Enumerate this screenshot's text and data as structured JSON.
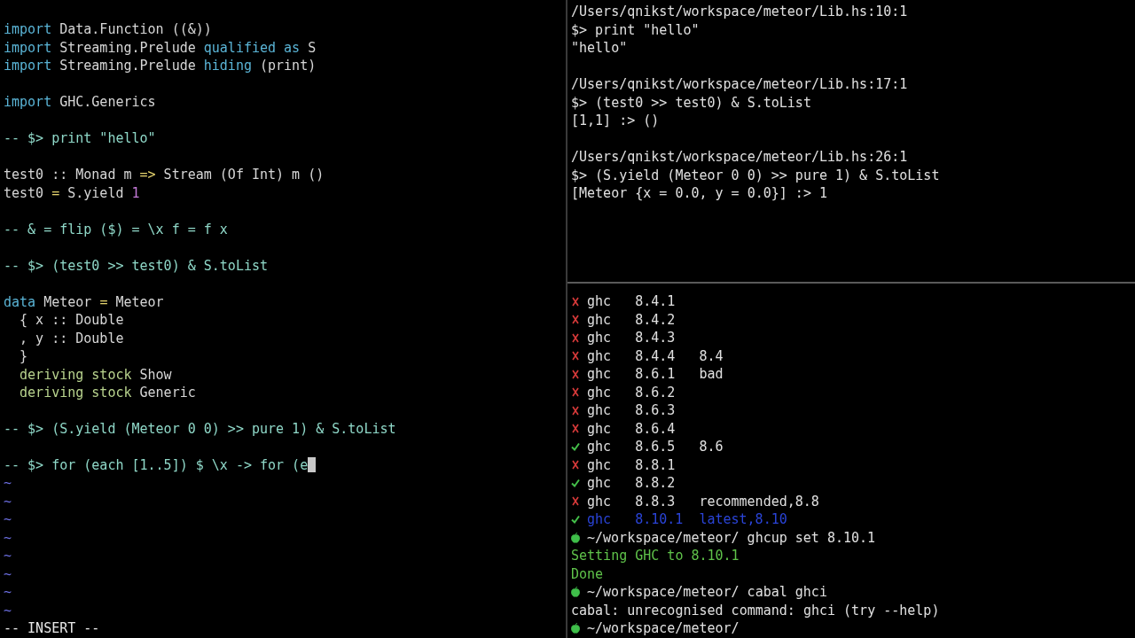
{
  "editor": {
    "lines": [
      {
        "kind": "blank"
      },
      {
        "kind": "code",
        "segments": [
          {
            "text": "import",
            "kind": "keyword"
          },
          {
            "text": " Data.Function ((&))",
            "kind": "plain"
          }
        ]
      },
      {
        "kind": "code",
        "segments": [
          {
            "text": "import",
            "kind": "keyword"
          },
          {
            "text": " Streaming.Prelude ",
            "kind": "plain"
          },
          {
            "text": "qualified as",
            "kind": "keyword"
          },
          {
            "text": " S",
            "kind": "plain"
          }
        ]
      },
      {
        "kind": "code",
        "segments": [
          {
            "text": "import",
            "kind": "keyword"
          },
          {
            "text": " Streaming.Prelude ",
            "kind": "plain"
          },
          {
            "text": "hiding",
            "kind": "keyword"
          },
          {
            "text": " (print)",
            "kind": "plain"
          }
        ]
      },
      {
        "kind": "blank"
      },
      {
        "kind": "code",
        "segments": [
          {
            "text": "import",
            "kind": "keyword"
          },
          {
            "text": " GHC.Generics",
            "kind": "plain"
          }
        ]
      },
      {
        "kind": "blank"
      },
      {
        "kind": "code",
        "segments": [
          {
            "text": "-- $> print \"hello\"",
            "kind": "comment"
          }
        ]
      },
      {
        "kind": "blank"
      },
      {
        "kind": "code",
        "segments": [
          {
            "text": "test0 :: Monad m ",
            "kind": "plain"
          },
          {
            "text": "=>",
            "kind": "operator"
          },
          {
            "text": " Stream (Of Int) m ()",
            "kind": "plain"
          }
        ]
      },
      {
        "kind": "code",
        "segments": [
          {
            "text": "test0 ",
            "kind": "plain"
          },
          {
            "text": "=",
            "kind": "operator"
          },
          {
            "text": " S.yield ",
            "kind": "plain"
          },
          {
            "text": "1",
            "kind": "number"
          }
        ]
      },
      {
        "kind": "blank"
      },
      {
        "kind": "code",
        "segments": [
          {
            "text": "-- & = flip ($) = \\x f = f x",
            "kind": "comment"
          }
        ]
      },
      {
        "kind": "blank"
      },
      {
        "kind": "code",
        "segments": [
          {
            "text": "-- $> (test0 >> test0) & S.toList",
            "kind": "comment"
          }
        ]
      },
      {
        "kind": "blank"
      },
      {
        "kind": "code",
        "segments": [
          {
            "text": "data",
            "kind": "keyword"
          },
          {
            "text": " Meteor ",
            "kind": "plain"
          },
          {
            "text": "=",
            "kind": "operator"
          },
          {
            "text": " Meteor",
            "kind": "plain"
          }
        ]
      },
      {
        "kind": "code",
        "segments": [
          {
            "text": "  { x :: Double",
            "kind": "plain"
          }
        ]
      },
      {
        "kind": "code",
        "segments": [
          {
            "text": "  , y :: Double",
            "kind": "plain"
          }
        ]
      },
      {
        "kind": "code",
        "segments": [
          {
            "text": "  }",
            "kind": "plain"
          }
        ]
      },
      {
        "kind": "code",
        "segments": [
          {
            "text": "  deriving stock",
            "kind": "deriving"
          },
          {
            "text": " Show",
            "kind": "plain"
          }
        ]
      },
      {
        "kind": "code",
        "segments": [
          {
            "text": "  deriving stock",
            "kind": "deriving"
          },
          {
            "text": " Generic",
            "kind": "plain"
          }
        ]
      },
      {
        "kind": "blank"
      },
      {
        "kind": "code",
        "segments": [
          {
            "text": "-- $> (S.yield (Meteor 0 0) >> pure 1) & S.toList",
            "kind": "comment"
          }
        ]
      },
      {
        "kind": "blank"
      },
      {
        "kind": "code_cursor",
        "segments": [
          {
            "text": "-- $> for (each [1..5]) $ \\x -> for (e",
            "kind": "comment"
          }
        ]
      },
      {
        "kind": "tilde",
        "text": "~"
      },
      {
        "kind": "tilde",
        "text": "~"
      },
      {
        "kind": "tilde",
        "text": "~"
      },
      {
        "kind": "tilde",
        "text": "~"
      },
      {
        "kind": "tilde",
        "text": "~"
      },
      {
        "kind": "tilde",
        "text": "~"
      },
      {
        "kind": "tilde",
        "text": "~"
      },
      {
        "kind": "tilde",
        "text": "~"
      }
    ],
    "mode": "-- INSERT --"
  },
  "repl": {
    "lines": [
      {
        "kind": "text",
        "text": "/Users/qnikst/workspace/meteor/Lib.hs:10:1"
      },
      {
        "kind": "text",
        "text": "$> print \"hello\""
      },
      {
        "kind": "text",
        "text": "\"hello\""
      },
      {
        "kind": "blank"
      },
      {
        "kind": "text",
        "text": "/Users/qnikst/workspace/meteor/Lib.hs:17:1"
      },
      {
        "kind": "text",
        "text": "$> (test0 >> test0) & S.toList"
      },
      {
        "kind": "text",
        "text": "[1,1] :> ()"
      },
      {
        "kind": "blank"
      },
      {
        "kind": "text",
        "text": "/Users/qnikst/workspace/meteor/Lib.hs:26:1"
      },
      {
        "kind": "text",
        "text": "$> (S.yield (Meteor 0 0) >> pure 1) & S.toList"
      },
      {
        "kind": "text",
        "text": "[Meteor {x = 0.0, y = 0.0}] :> 1"
      }
    ]
  },
  "ghcup": {
    "rows": [
      {
        "installed": false,
        "tool": "ghc",
        "version": "8.4.1",
        "selected": false
      },
      {
        "installed": false,
        "tool": "ghc",
        "version": "8.4.2",
        "selected": false
      },
      {
        "installed": false,
        "tool": "ghc",
        "version": "8.4.3",
        "selected": false
      },
      {
        "installed": false,
        "tool": "ghc",
        "version": "8.4.4",
        "tag": "8.4",
        "selected": false
      },
      {
        "installed": false,
        "tool": "ghc",
        "version": "8.6.1",
        "tag": "bad",
        "selected": false
      },
      {
        "installed": false,
        "tool": "ghc",
        "version": "8.6.2",
        "selected": false
      },
      {
        "installed": false,
        "tool": "ghc",
        "version": "8.6.3",
        "selected": false
      },
      {
        "installed": false,
        "tool": "ghc",
        "version": "8.6.4",
        "selected": false
      },
      {
        "installed": true,
        "tool": "ghc",
        "version": "8.6.5",
        "tag": "8.6",
        "selected": false
      },
      {
        "installed": false,
        "tool": "ghc",
        "version": "8.8.1",
        "selected": false
      },
      {
        "installed": true,
        "tool": "ghc",
        "version": "8.8.2",
        "selected": false
      },
      {
        "installed": false,
        "tool": "ghc",
        "version": "8.8.3",
        "tag": "recommended,8.8",
        "selected": false
      },
      {
        "installed": true,
        "tool": "ghc",
        "version": "8.10.1",
        "tag": "latest,8.10",
        "selected": true
      }
    ],
    "shell": [
      {
        "kind": "prompt",
        "text": "~/workspace/meteor/ ghcup set 8.10.1"
      },
      {
        "kind": "success",
        "text": "Setting GHC to 8.10.1"
      },
      {
        "kind": "success",
        "text": "Done"
      },
      {
        "kind": "prompt",
        "text": "~/workspace/meteor/ cabal ghci"
      },
      {
        "kind": "output",
        "text": "cabal: unrecognised command: ghci (try --help)"
      },
      {
        "kind": "prompt",
        "text": "~/workspace/meteor/"
      }
    ]
  }
}
